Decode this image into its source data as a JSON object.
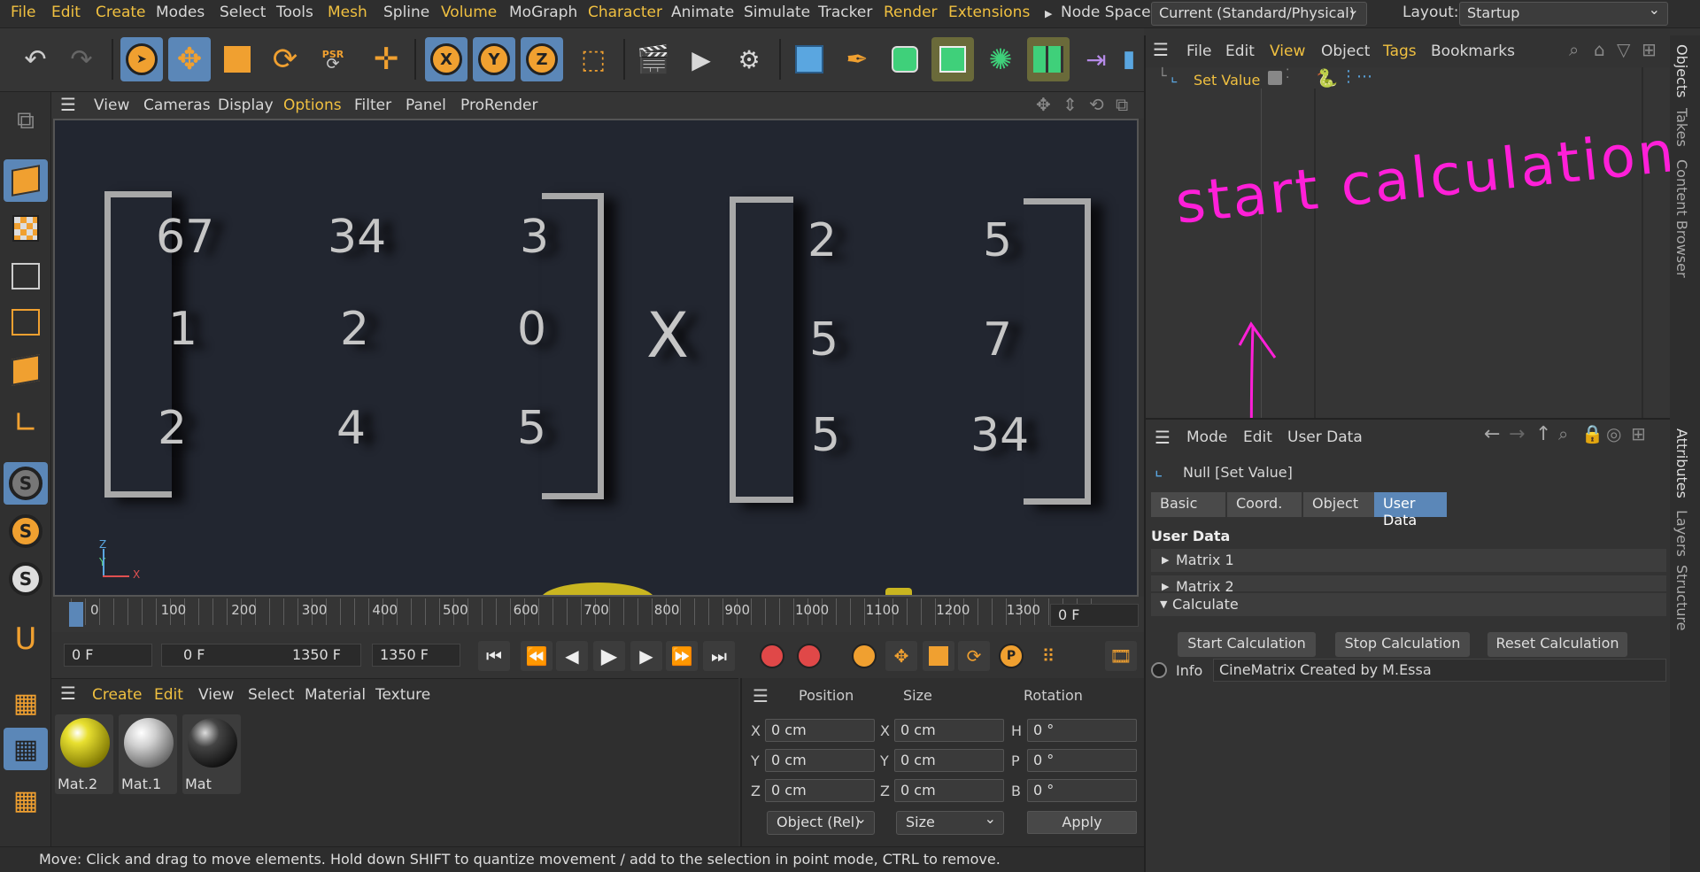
{
  "menu": {
    "items": [
      "File",
      "Edit",
      "Create",
      "Modes",
      "Select",
      "Tools",
      "Mesh",
      "Spline",
      "Volume",
      "MoGraph",
      "Character",
      "Animate",
      "Simulate",
      "Tracker",
      "Render",
      "Extensions"
    ],
    "node_space_label": "Node Space:",
    "node_space_value": "Current (Standard/Physical)",
    "layout_label": "Layout:",
    "layout_value": "Startup"
  },
  "toolbar": {
    "axis_labels": [
      "X",
      "Y",
      "Z"
    ],
    "psr_label": "PSR"
  },
  "viewport": {
    "menu": [
      "View",
      "Cameras",
      "Display",
      "Options",
      "Filter",
      "Panel",
      "ProRender"
    ],
    "matrix_a": [
      [
        "67",
        "34",
        "3"
      ],
      [
        "1",
        "2",
        "0"
      ],
      [
        "2",
        "4",
        "5"
      ]
    ],
    "operator": "X",
    "matrix_b": [
      [
        "2",
        "5"
      ],
      [
        "5",
        "7"
      ],
      [
        "5",
        "34"
      ]
    ],
    "axis_z": "Z",
    "axis_y": "Y",
    "axis_x": "X"
  },
  "timeline": {
    "ticks": [
      "0",
      "100",
      "200",
      "300",
      "400",
      "500",
      "600",
      "700",
      "800",
      "900",
      "1000",
      "1100",
      "1200",
      "1300"
    ],
    "current_frame": "0 F"
  },
  "playbar": {
    "start": "0 F",
    "range_start": "0 F",
    "range_end": "1350 F",
    "end": "1350 F"
  },
  "materials": {
    "menu": [
      "Create",
      "Edit",
      "View",
      "Select",
      "Material",
      "Texture"
    ],
    "items": [
      "Mat.2",
      "Mat.1",
      "Mat"
    ]
  },
  "coords": {
    "headers": [
      "Position",
      "Size",
      "Rotation"
    ],
    "position": [
      {
        "axis": "X",
        "value": "0 cm"
      },
      {
        "axis": "Y",
        "value": "0 cm"
      },
      {
        "axis": "Z",
        "value": "0 cm"
      }
    ],
    "size": [
      {
        "axis": "X",
        "value": "0 cm"
      },
      {
        "axis": "Y",
        "value": "0 cm"
      },
      {
        "axis": "Z",
        "value": "0 cm"
      }
    ],
    "rotation": [
      {
        "axis": "H",
        "value": "0 °"
      },
      {
        "axis": "P",
        "value": "0 °"
      },
      {
        "axis": "B",
        "value": "0 °"
      }
    ],
    "mode": "Object (Rel)",
    "size_mode": "Size",
    "apply": "Apply"
  },
  "status": "Move: Click and drag to move elements. Hold down SHIFT to quantize movement / add to the selection in point mode, CTRL to remove.",
  "objects": {
    "menu": [
      "File",
      "Edit",
      "View",
      "Object",
      "Tags",
      "Bookmarks"
    ],
    "item": "Set Value",
    "annotation": "start calculation"
  },
  "right_tabs": [
    "Objects",
    "Takes",
    "Content Browser",
    "Attributes",
    "Layers",
    "Structure"
  ],
  "attributes": {
    "menu": [
      "Mode",
      "Edit",
      "User Data"
    ],
    "title": "Null [Set Value]",
    "tabs": [
      "Basic",
      "Coord.",
      "Object",
      "User Data"
    ],
    "section": "User Data",
    "groups": [
      "Matrix  1",
      "Matrix 2",
      "Calculate"
    ],
    "buttons": [
      "Start  Calculation",
      "Stop Calculation",
      "Reset Calculation"
    ],
    "info_label": "Info",
    "info_value": "CineMatrix Created by M.Essa"
  },
  "colors": {
    "accent": "#f0c040",
    "selection": "#5b87b8",
    "annotation": "#ff1fd8"
  }
}
